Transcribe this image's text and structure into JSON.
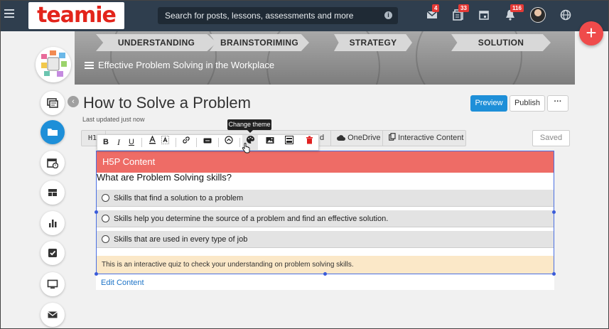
{
  "topbar": {
    "logo_text": "teamie",
    "search_placeholder": "Search for posts, lessons, assessments and more",
    "mail_badge": "4",
    "posts_badge": "33",
    "notifications_badge": "116",
    "create_label": "+"
  },
  "banner": {
    "steps": [
      "UNDERSTANDING",
      "BRAINSTORIMING",
      "STRATEGY",
      "SOLUTION"
    ],
    "title": "Effective Problem Solving in the Workplace"
  },
  "page": {
    "title": "How to Solve a Problem",
    "updated": "Last updated just now",
    "back_label": "‹"
  },
  "actions": {
    "preview": "Preview",
    "publish": "Publish",
    "more": "···"
  },
  "editor_toolbar": {
    "heading": "H1",
    "partial": "d",
    "onedrive": "OneDrive",
    "interactive": "Interactive Content",
    "status": "Saved"
  },
  "format_toolbar": {
    "bold": "B",
    "italic": "I",
    "underline": "U",
    "tooltip": "Change theme"
  },
  "h5p": {
    "header": "H5P Content",
    "question": "What are Problem Solving skills?",
    "options": [
      "Skills that find a solution to a problem",
      "Skills help you determine the source of a problem and find an effective solution.",
      "Skills that are used in every type of job"
    ],
    "note": "This is an interactive quiz to check your understanding on problem solving skills.",
    "edit_link": "Edit Content"
  },
  "colors": {
    "topbar": "#2f3e4e",
    "accent": "#1e8fd8",
    "h5p_header": "#ee6c66",
    "note_bg": "#fbe8c8",
    "fab": "#ef4b4b"
  },
  "rail_icons": [
    "updates-icon",
    "folder-icon",
    "calendar-icon",
    "dashboard-icon",
    "analytics-icon",
    "checklist-icon",
    "monitor-icon",
    "mail-icon"
  ]
}
